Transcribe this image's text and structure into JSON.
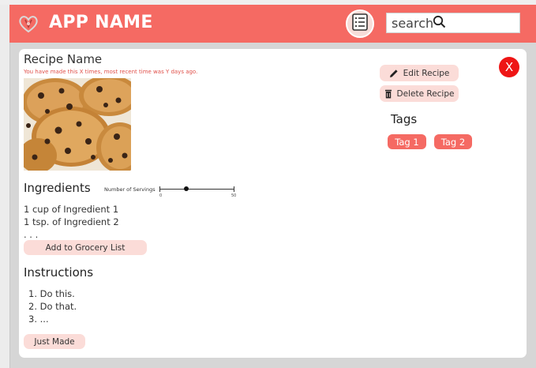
{
  "header": {
    "app_name": "APP NAME",
    "logo_icon": "heart-logo-icon",
    "menu_icon": "list-menu-icon",
    "search_placeholder": "search",
    "search_icon": "search-icon",
    "bar_color": "#f56a63"
  },
  "recipe": {
    "name": "Recipe Name",
    "made_note": "You have made this X times, most recent time was Y days ago.",
    "image_icon": "chocolate-chip-cookies-image",
    "edit_label": "Edit Recipe",
    "delete_label": "Delete Recipe",
    "close_label": "X",
    "tags_heading": "Tags",
    "tags": [
      "Tag 1",
      "Tag 2"
    ],
    "ingredients_heading": "Ingredients",
    "servings": {
      "label": "Number of Servings",
      "min": "0",
      "max": "50",
      "value_fraction": 0.36
    },
    "ingredients": [
      "1 cup of Ingredient 1",
      "1 tsp. of Ingredient 2",
      ". . ."
    ],
    "grocery_label": "Add to Grocery List",
    "instructions_heading": "Instructions",
    "instructions": [
      "1. Do this.",
      "2. Do that.",
      "3. ..."
    ],
    "just_made_label": "Just Made"
  },
  "colors": {
    "accent": "#f56a63",
    "pill": "#fbdcd8",
    "close": "#ee1515",
    "note": "#e0504a"
  }
}
